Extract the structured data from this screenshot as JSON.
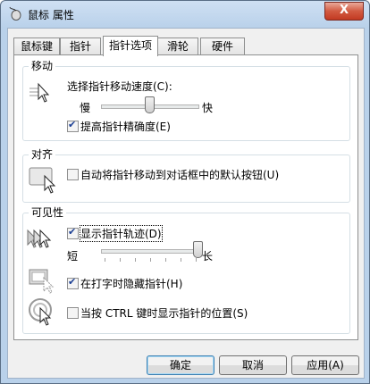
{
  "window": {
    "title": "鼠标 属性",
    "close_glyph": "X"
  },
  "tabs": [
    "鼠标键",
    "指针",
    "指针选项",
    "滑轮",
    "硬件"
  ],
  "motion": {
    "group_title": "移动",
    "speed_label": "选择指针移动速度(C):",
    "slow": "慢",
    "fast": "快",
    "speed_level": 0.5,
    "precision_label": "提高指针精确度(E)",
    "precision_checked": true
  },
  "snap": {
    "group_title": "对齐",
    "snap_label": "自动将指针移动到对话框中的默认按钮(U)",
    "snap_checked": false
  },
  "visibility": {
    "group_title": "可见性",
    "trails_label": "显示指针轨迹(D)",
    "trails_checked": true,
    "short": "短",
    "long": "长",
    "trail_level": 1.0,
    "hide_label": "在打字时隐藏指针(H)",
    "hide_checked": true,
    "ctrl_label": "当按 CTRL 键时显示指针的位置(S)",
    "ctrl_checked": false
  },
  "buttons": {
    "ok": "确定",
    "cancel": "取消",
    "apply": "应用(A)"
  },
  "icons": [
    "mouse-icon",
    "pointer-speed-icon",
    "snap-icon",
    "trails-icon",
    "hide-pointer-icon",
    "locate-pointer-icon"
  ]
}
